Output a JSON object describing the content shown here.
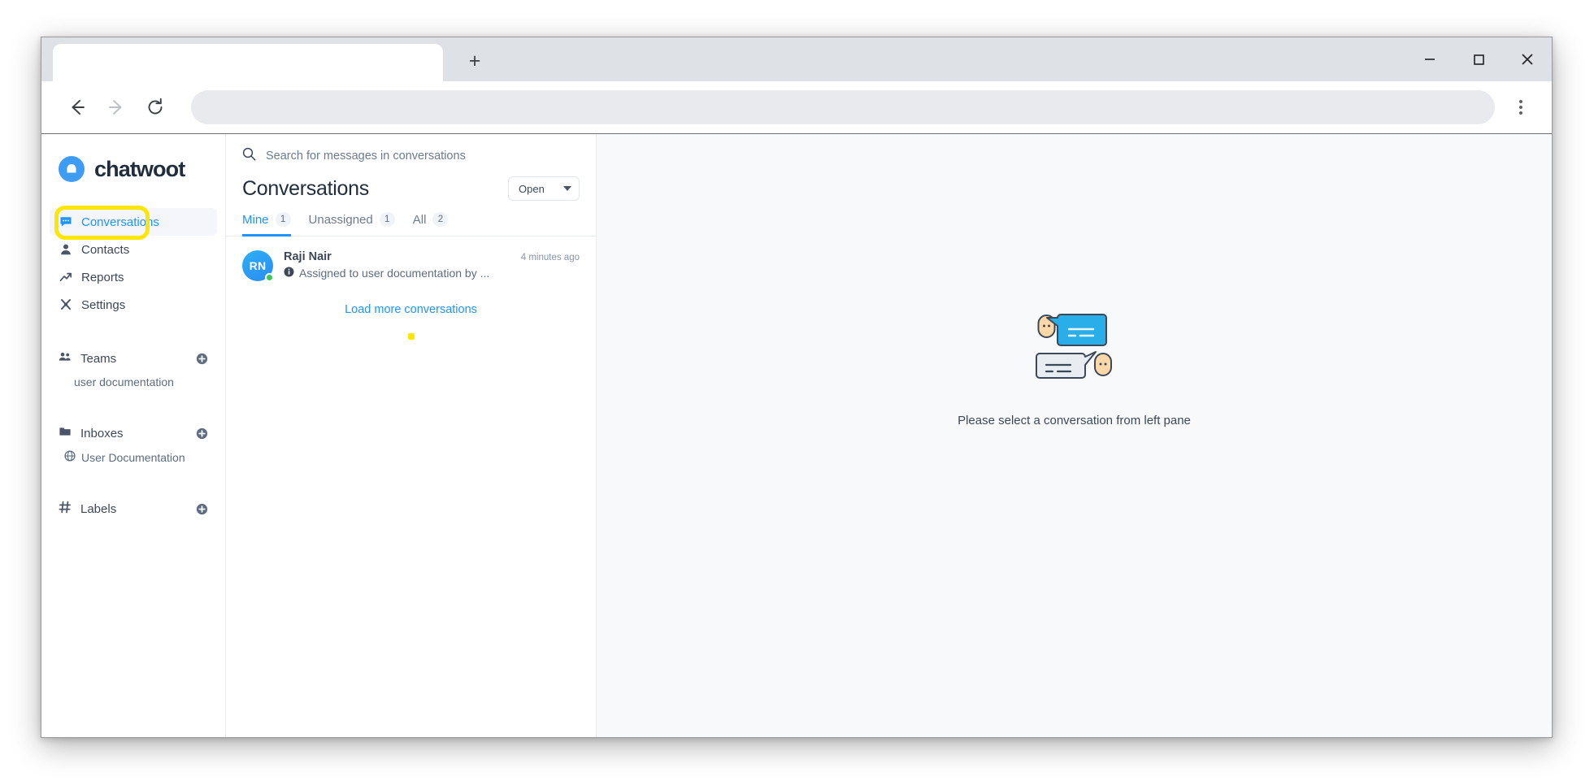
{
  "browser": {
    "tab_title": "",
    "new_tab_label": "+",
    "url_value": "",
    "url_placeholder": "",
    "back_icon": "back-arrow-icon",
    "forward_icon": "forward-arrow-icon",
    "reload_icon": "reload-icon",
    "menu_icon": "kebab-menu-icon",
    "minimize_icon": "minimize-icon",
    "maximize_icon": "maximize-icon",
    "close_icon": "close-icon"
  },
  "sidebar": {
    "brand": {
      "wordmark": "chatwoot",
      "logo_icon": "chatwoot-logo-icon",
      "logo_color": "#3f9cf4"
    },
    "nav": [
      {
        "label": "Conversations",
        "icon": "chat-bubble-icon",
        "active": true
      },
      {
        "label": "Contacts",
        "icon": "person-icon",
        "active": false
      },
      {
        "label": "Reports",
        "icon": "trend-line-icon",
        "active": false
      },
      {
        "label": "Settings",
        "icon": "settings-icon",
        "active": false
      }
    ],
    "sections": [
      {
        "title": "Teams",
        "icon": "people-icon",
        "add_icon": "plus-circle-icon",
        "children": [
          {
            "label": "user documentation",
            "icon": null
          }
        ]
      },
      {
        "title": "Inboxes",
        "icon": "folder-icon",
        "add_icon": "plus-circle-icon",
        "children": [
          {
            "label": "User Documentation",
            "icon": "globe-icon"
          }
        ]
      },
      {
        "title": "Labels",
        "icon": "hash-icon",
        "add_icon": "plus-circle-icon",
        "children": []
      }
    ],
    "highlight_color": "#ffe600",
    "highlighted_item": "Contacts"
  },
  "conversations": {
    "search_placeholder": "Search for messages in conversations",
    "search_value": "",
    "search_icon": "search-icon",
    "heading": "Conversations",
    "status_filter": {
      "value": "Open",
      "caret_icon": "chevron-down-icon"
    },
    "tabs": [
      {
        "label": "Mine",
        "count": "1",
        "active": true
      },
      {
        "label": "Unassigned",
        "count": "1",
        "active": false
      },
      {
        "label": "All",
        "count": "2",
        "active": false
      }
    ],
    "items": [
      {
        "name": "Raji Nair",
        "initials": "RN",
        "time": "4 minutes ago",
        "preview": "Assigned to user documentation by ...",
        "preview_icon": "info-icon",
        "online": true
      }
    ],
    "load_more_label": "Load more conversations",
    "accent_color": "#1f93ff"
  },
  "main": {
    "empty_state_caption": "Please select a conversation from left pane",
    "illustration_icon": "two-chat-bubbles-with-faces-illustration",
    "bubble_blue": "#2aaeea",
    "bubble_grey": "#e8edf1",
    "face_color": "#fcd7a8"
  }
}
